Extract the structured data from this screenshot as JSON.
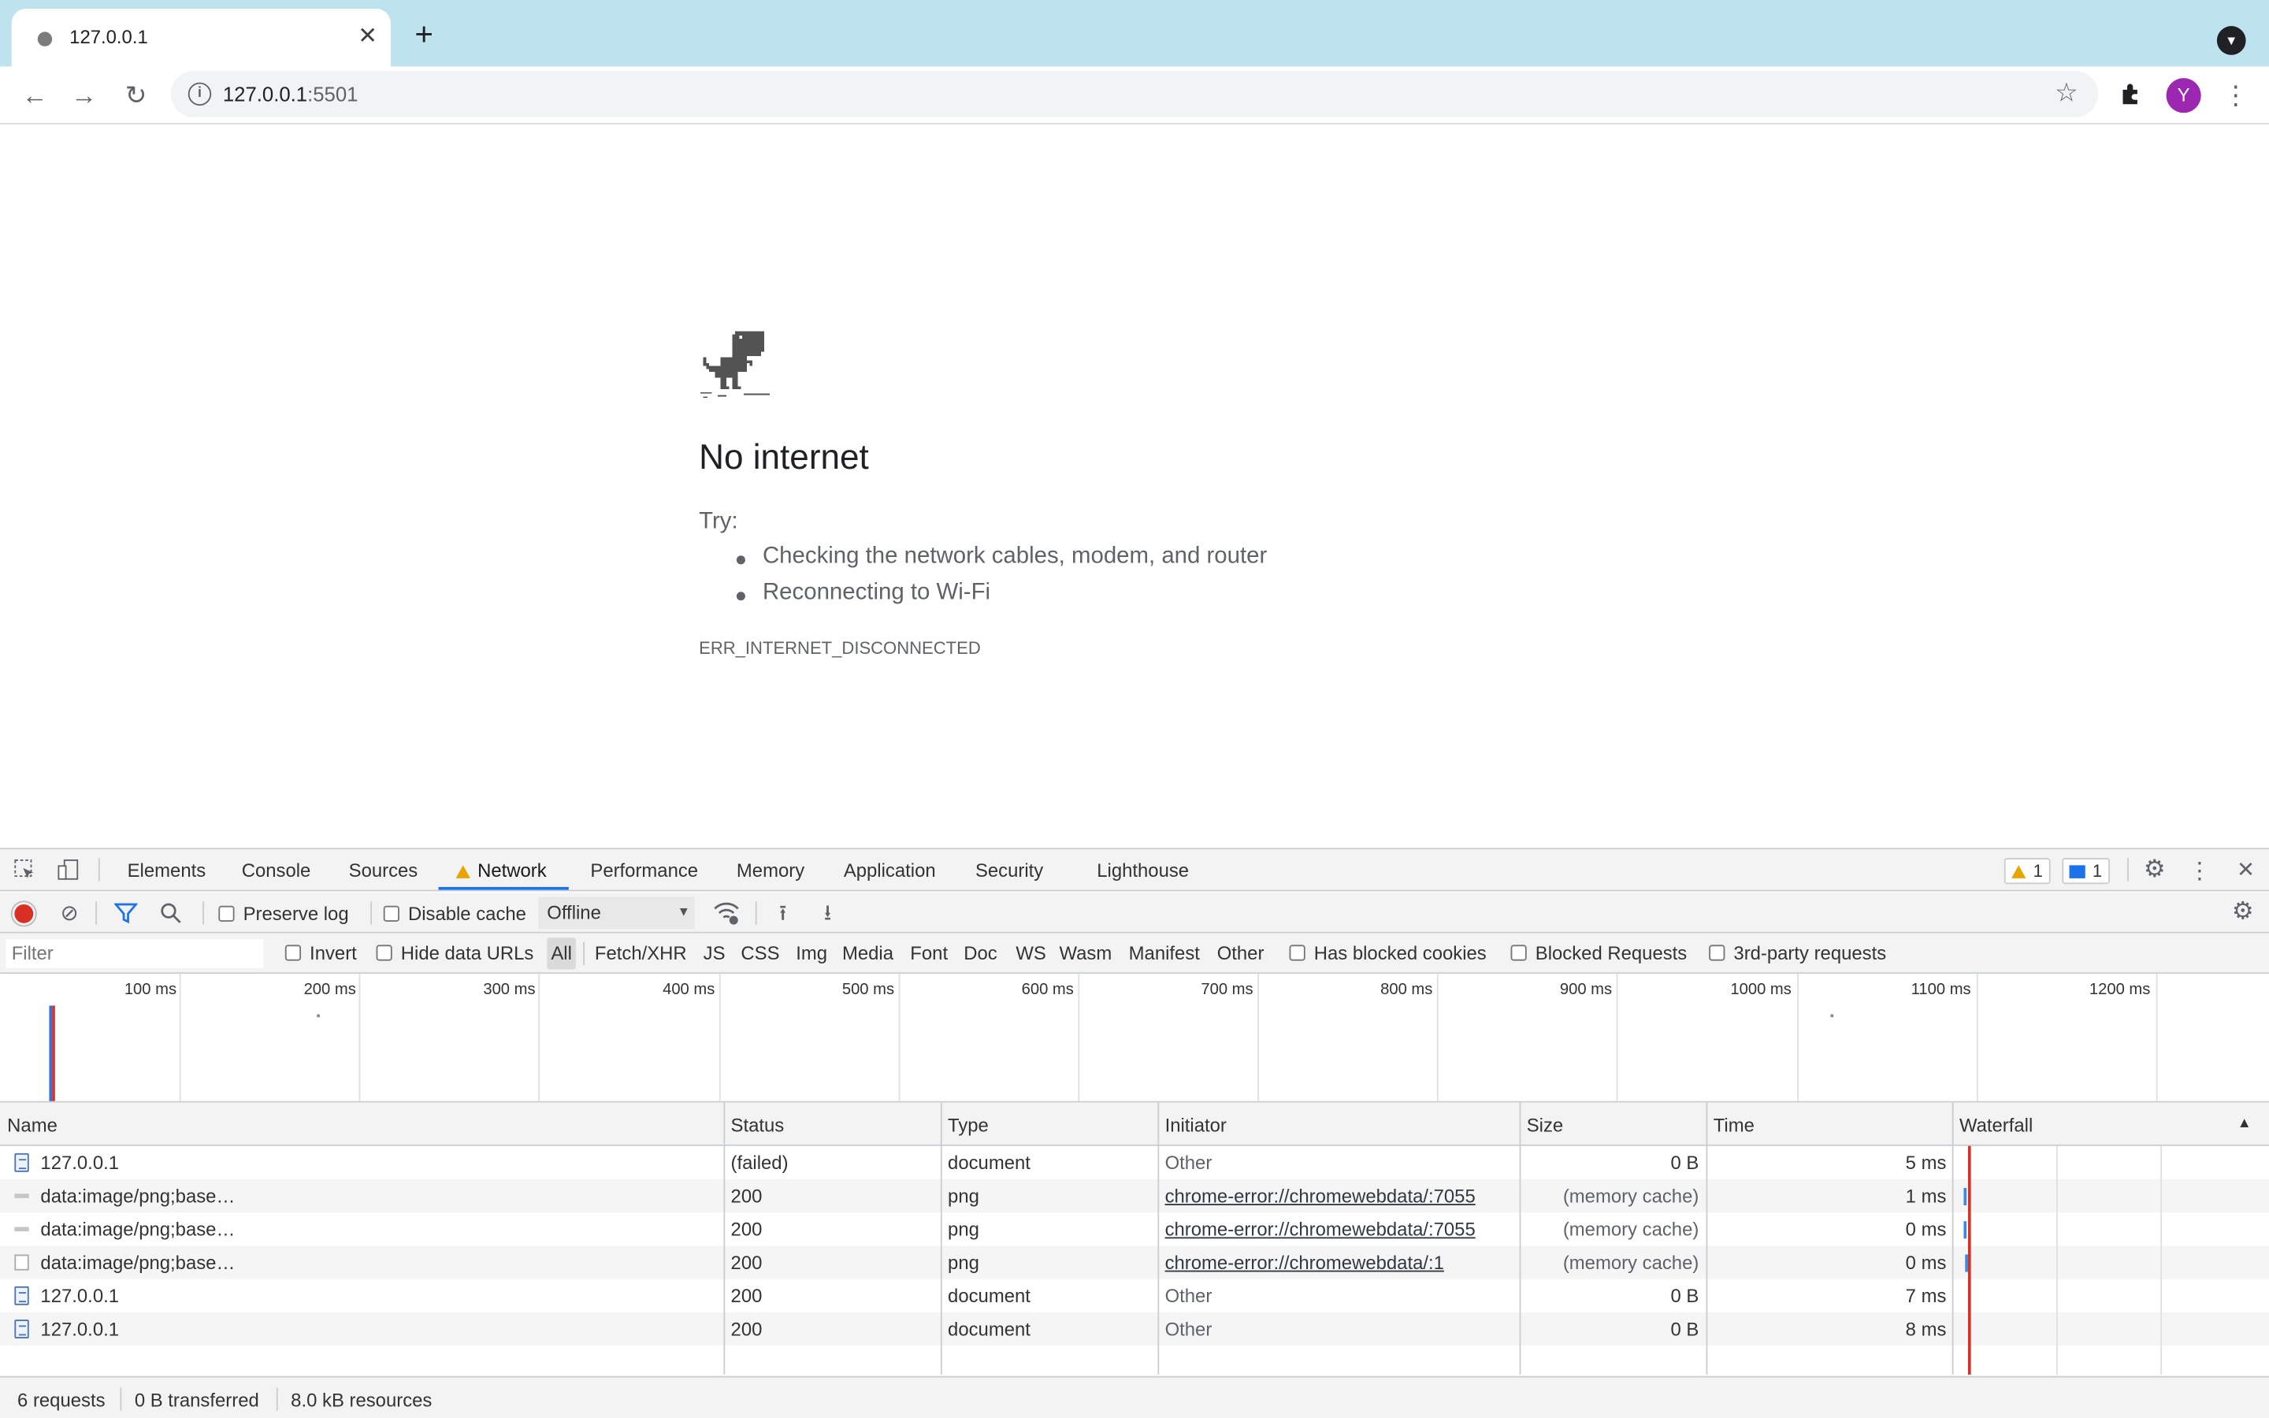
{
  "browser": {
    "tab_title": "127.0.0.1",
    "url_host": "127.0.0.1",
    "url_port": ":5501",
    "avatar_letter": "Y"
  },
  "error_page": {
    "title": "No internet",
    "try_label": "Try:",
    "suggestions": [
      "Checking the network cables, modem, and router",
      "Reconnecting to Wi-Fi"
    ],
    "error_code": "ERR_INTERNET_DISCONNECTED"
  },
  "devtools": {
    "tabs": [
      "Elements",
      "Console",
      "Sources",
      "Network",
      "Performance",
      "Memory",
      "Application",
      "Security",
      "Lighthouse"
    ],
    "active_tab": "Network",
    "warnings_count": "1",
    "messages_count": "1",
    "toolbar": {
      "preserve_log": "Preserve log",
      "disable_cache": "Disable cache",
      "throttling": "Offline"
    },
    "filter": {
      "placeholder": "Filter",
      "invert": "Invert",
      "hide_data_urls": "Hide data URLs",
      "types": [
        "All",
        "Fetch/XHR",
        "JS",
        "CSS",
        "Img",
        "Media",
        "Font",
        "Doc",
        "WS",
        "Wasm",
        "Manifest",
        "Other"
      ],
      "has_blocked_cookies": "Has blocked cookies",
      "blocked_requests": "Blocked Requests",
      "third_party": "3rd-party requests"
    },
    "overview_ticks": [
      "100 ms",
      "200 ms",
      "300 ms",
      "400 ms",
      "500 ms",
      "600 ms",
      "700 ms",
      "800 ms",
      "900 ms",
      "1000 ms",
      "1100 ms",
      "1200 ms"
    ],
    "columns": [
      "Name",
      "Status",
      "Type",
      "Initiator",
      "Size",
      "Time",
      "Waterfall"
    ],
    "rows": [
      {
        "name": "127.0.0.1",
        "status": "(failed)",
        "type": "document",
        "initiator": "Other",
        "size": "0 B",
        "time": "5 ms"
      },
      {
        "name": "data:image/png;base…",
        "status": "200",
        "type": "png",
        "initiator": "chrome-error://chromewebdata/:7055",
        "size": "(memory cache)",
        "time": "1 ms"
      },
      {
        "name": "data:image/png;base…",
        "status": "200",
        "type": "png",
        "initiator": "chrome-error://chromewebdata/:7055",
        "size": "(memory cache)",
        "time": "0 ms"
      },
      {
        "name": "data:image/png;base…",
        "status": "200",
        "type": "png",
        "initiator": "chrome-error://chromewebdata/:1",
        "size": "(memory cache)",
        "time": "0 ms"
      },
      {
        "name": "127.0.0.1",
        "status": "200",
        "type": "document",
        "initiator": "Other",
        "size": "0 B",
        "time": "7 ms"
      },
      {
        "name": "127.0.0.1",
        "status": "200",
        "type": "document",
        "initiator": "Other",
        "size": "0 B",
        "time": "8 ms"
      }
    ],
    "summary": {
      "requests": "6 requests",
      "transferred": "0 B transferred",
      "resources": "8.0 kB resources"
    }
  }
}
